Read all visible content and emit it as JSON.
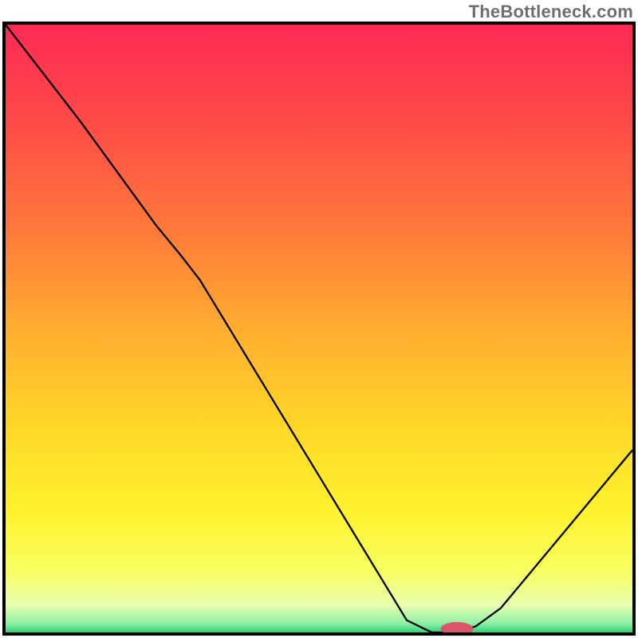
{
  "watermark": "TheBottleneck.com",
  "chart_data": {
    "type": "line",
    "title": "",
    "xlabel": "",
    "ylabel": "",
    "xlim": [
      0,
      100
    ],
    "ylim": [
      0,
      100
    ],
    "gradient_stops": [
      {
        "offset": 0.0,
        "color": "#ff2a55"
      },
      {
        "offset": 0.16,
        "color": "#ff4b48"
      },
      {
        "offset": 0.34,
        "color": "#ff7a3a"
      },
      {
        "offset": 0.5,
        "color": "#ffad30"
      },
      {
        "offset": 0.66,
        "color": "#ffd727"
      },
      {
        "offset": 0.8,
        "color": "#fff22e"
      },
      {
        "offset": 0.9,
        "color": "#f7ff60"
      },
      {
        "offset": 0.955,
        "color": "#e9ffb0"
      },
      {
        "offset": 0.985,
        "color": "#8ef0a5"
      },
      {
        "offset": 1.0,
        "color": "#2fd37a"
      }
    ],
    "series": [
      {
        "name": "bottleneck-curve",
        "color": "#000000",
        "width": 2.3,
        "x": [
          0,
          12,
          24,
          28,
          31,
          64,
          68,
          72,
          75,
          79,
          100
        ],
        "values": [
          100,
          84,
          67,
          62,
          58,
          2,
          0,
          0,
          1,
          4,
          30
        ]
      }
    ],
    "marker": {
      "name": "optimum-marker",
      "x": 72,
      "y": 0.6,
      "color": "#d9566a",
      "rx": 2.6,
      "ry": 1.1
    }
  }
}
